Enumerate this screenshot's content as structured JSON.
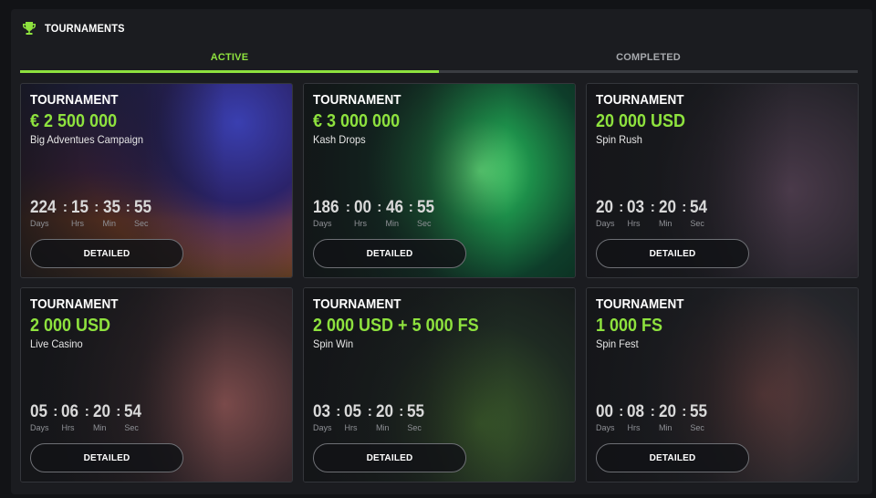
{
  "header": {
    "title": "TOURNAMENTS",
    "icon": "trophy-icon",
    "accent": "#8ee23e"
  },
  "tabs": [
    {
      "label": "ACTIVE",
      "active": true
    },
    {
      "label": "COMPLETED",
      "active": false
    }
  ],
  "timer_labels": {
    "days": "Days",
    "hrs": "Hrs",
    "min": "Min",
    "sec": "Sec"
  },
  "cards": [
    {
      "label": "TOURNAMENT",
      "prize": "€ 2 500 000",
      "name": "Big Adventues Campaign",
      "days": "224",
      "hrs": "15",
      "min": "35",
      "sec": "55",
      "button": "DETAILED"
    },
    {
      "label": "TOURNAMENT",
      "prize": "€ 3 000 000",
      "name": "Kash Drops",
      "days": "186",
      "hrs": "00",
      "min": "46",
      "sec": "55",
      "button": "DETAILED"
    },
    {
      "label": "TOURNAMENT",
      "prize": "20 000 USD",
      "name": "Spin Rush",
      "days": "20",
      "hrs": "03",
      "min": "20",
      "sec": "54",
      "button": "DETAILED"
    },
    {
      "label": "TOURNAMENT",
      "prize": "2 000 USD",
      "name": "Live Casino",
      "days": "05",
      "hrs": "06",
      "min": "20",
      "sec": "54",
      "button": "DETAILED"
    },
    {
      "label": "TOURNAMENT",
      "prize": "2 000 USD + 5 000 FS",
      "name": "Spin Win",
      "days": "03",
      "hrs": "05",
      "min": "20",
      "sec": "55",
      "button": "DETAILED"
    },
    {
      "label": "TOURNAMENT",
      "prize": "1 000 FS",
      "name": "Spin Fest",
      "days": "00",
      "hrs": "08",
      "min": "20",
      "sec": "55",
      "button": "DETAILED"
    }
  ]
}
